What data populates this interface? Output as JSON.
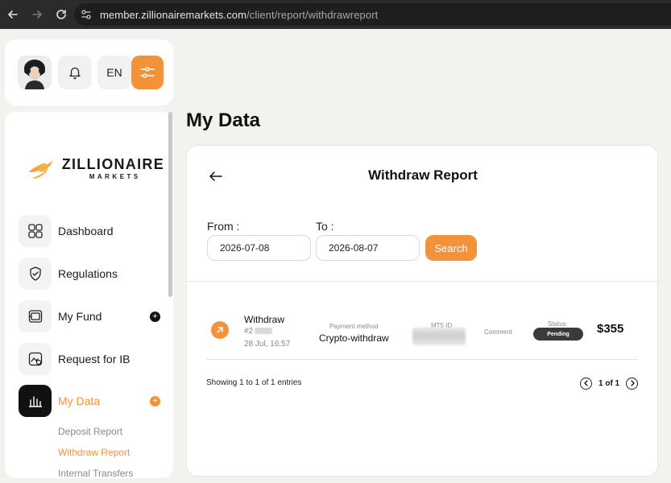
{
  "browser": {
    "url_host": "member.zillionairemarkets.com",
    "url_path": "/client/report/withdrawreport"
  },
  "top_controls": {
    "language": "EN"
  },
  "sidebar": {
    "logo_title": "ZILLIONAIRE",
    "logo_sub": "MARKETS",
    "items": [
      {
        "label": "Dashboard",
        "icon": "grid-icon"
      },
      {
        "label": "Regulations",
        "icon": "shield-check-icon"
      },
      {
        "label": "My Fund",
        "icon": "wallet-icon",
        "badge": "+"
      },
      {
        "label": "Request for IB",
        "icon": "ib-request-icon"
      },
      {
        "label": "My Data",
        "icon": "bar-chart-icon",
        "badge": "+"
      }
    ],
    "sub_items": [
      {
        "label": "Deposit Report"
      },
      {
        "label": "Withdraw Report"
      },
      {
        "label": "Internal Transfers"
      }
    ]
  },
  "main": {
    "page_title": "My Data",
    "card_title": "Withdraw Report",
    "from_label": "From :",
    "to_label": "To :",
    "from_value": "2026-07-08",
    "to_value": "2026-08-07",
    "search_label": "Search"
  },
  "record": {
    "type": "Withdraw",
    "id_prefix": "#2",
    "date": "28 Jul, 16:57",
    "payment_method_label": "Payment method",
    "payment_method": "Crypto-withdraw",
    "mt5_label": "MT5 ID",
    "comment_label": "Comment",
    "status_label": "Status",
    "status": "Pending",
    "amount": "$355"
  },
  "footer": {
    "entries": "Showing 1 to 1 of 1 entries",
    "page": "1 of 1"
  },
  "colors": {
    "accent": "#f4923a",
    "dark": "#111111"
  }
}
